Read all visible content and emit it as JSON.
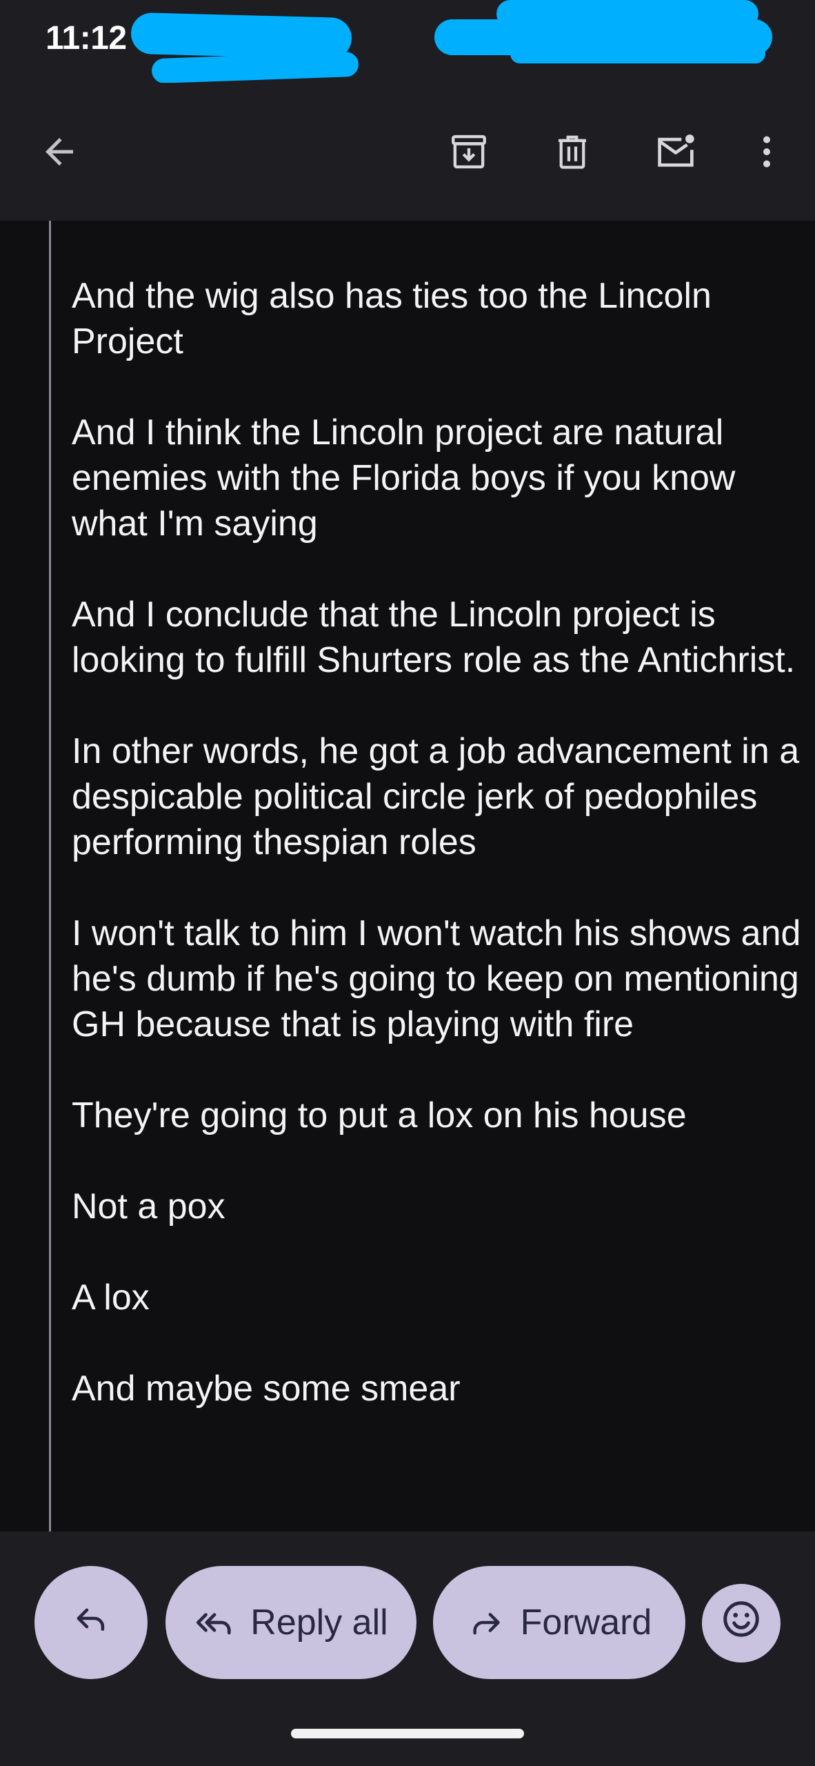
{
  "status_bar": {
    "time": "11:12"
  },
  "toolbar": {
    "icons": [
      "back-arrow-icon",
      "archive-icon",
      "delete-icon",
      "mark-unread-icon",
      "more-vert-icon"
    ]
  },
  "message": {
    "paragraphs": [
      "And the wig also has ties too the Lincoln Project",
      "And I think the Lincoln project are natural enemies with the Florida boys if you know what I'm saying",
      "And I conclude that the Lincoln project is looking to fulfill Shurters role as the Antichrist.",
      "In other words, he got a job advancement in a despicable political circle jerk of pedophiles performing thespian roles",
      "I won't talk to him I won't watch his shows and he's dumb if he's going to keep on mentioning GH because that is playing with fire",
      "They're going to put a lox on his house",
      "Not a pox",
      "A lox",
      "And maybe some smear"
    ]
  },
  "actions": {
    "reply_all": "Reply all",
    "forward": "Forward"
  },
  "colors": {
    "background": "#0f0f12",
    "bar_background": "#1d1d22",
    "pill_background": "#c9c3e0",
    "pill_text": "#2a2740",
    "redaction": "#00b0ff"
  }
}
